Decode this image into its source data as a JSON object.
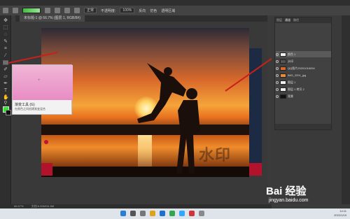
{
  "options_bar": {
    "mode_label": "正常",
    "opacity_label": "不透明度:",
    "opacity_value": "100%",
    "reverse_label": "反向",
    "dither_label": "仿色",
    "transparency_label": "透明区域"
  },
  "document_tab": {
    "title": "未标题-1 @ 66.7% (图层 1, RGB/8#)"
  },
  "tooltip": {
    "title": "渐变工具 (G)",
    "description": "在颜色之间创建渐变混合"
  },
  "watermark": {
    "text": "水印"
  },
  "layers_panel": {
    "tabs": [
      "图层",
      "通道",
      "路径"
    ],
    "rows": [
      {
        "name": "颜色 1",
        "thumb": "#f4f4f4",
        "selected": true
      },
      {
        "name": "水印",
        "thumb": "#555555",
        "selected": false
      },
      {
        "name": "QQ图片20201016094",
        "thumb": "#d9692a",
        "selected": false
      },
      {
        "name": "IMG_2201_jpg",
        "thumb": "#e88c3a",
        "selected": false
      },
      {
        "name": "图层 1",
        "thumb": "#f0f0f0",
        "selected": false
      },
      {
        "name": "图层 1 拷贝 2",
        "thumb": "#ededed",
        "selected": false
      },
      {
        "name": "背景",
        "thumb": "#111111",
        "selected": false
      }
    ]
  },
  "status_bar": {
    "zoom": "66.67%",
    "doc": "文档:6.05M/34.8M"
  },
  "taskbar": {
    "time": "14:11",
    "date": "2022/1/19"
  },
  "brand": {
    "name": "Bai 经验",
    "url": "jingyan.baidu.com"
  },
  "colors": {
    "foreground": "#2ee82e",
    "background": "#111111",
    "accent_red": "#c8201a"
  }
}
